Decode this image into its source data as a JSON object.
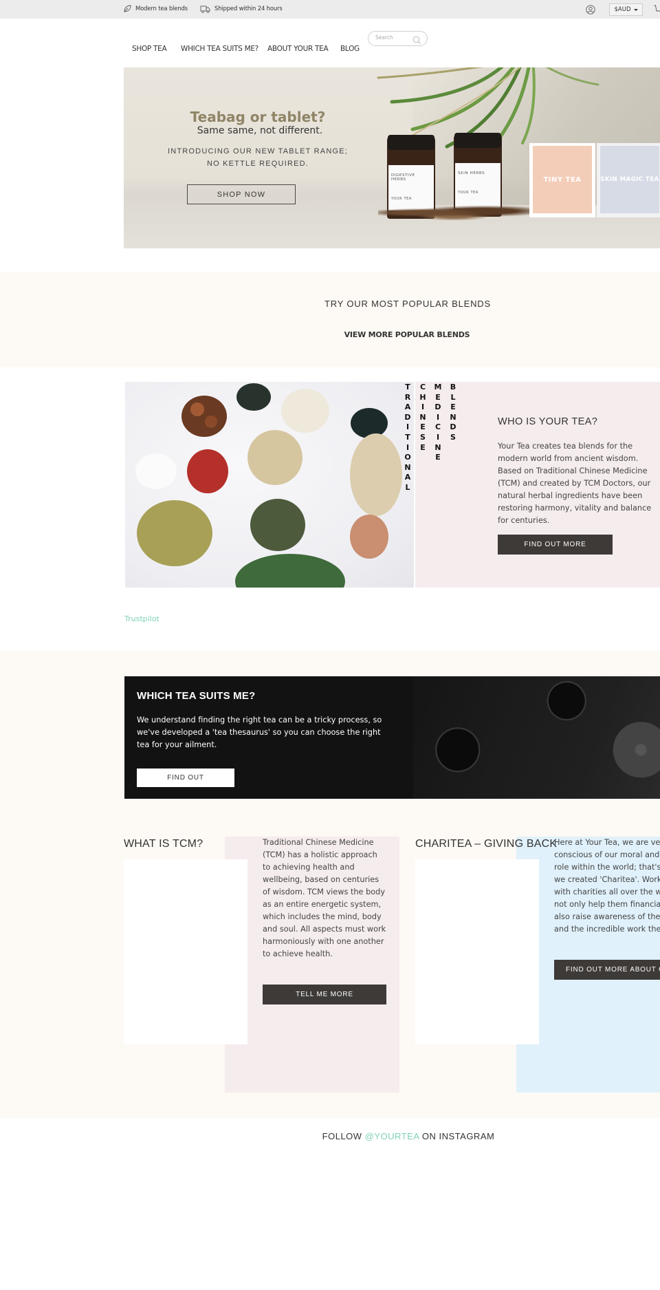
{
  "topbar": {
    "features": [
      {
        "icon": "leaf-icon",
        "label": "Modern tea blends"
      },
      {
        "icon": "truck-icon",
        "label": "Shipped within 24 hours"
      }
    ],
    "currency": "$AUD"
  },
  "nav": {
    "items": [
      "SHOP TEA",
      "WHICH TEA SUITS ME?",
      "ABOUT YOUR TEA",
      "BLOG"
    ],
    "search_placeholder": "Search"
  },
  "hero": {
    "title": "Teabag or tablet?",
    "subtitle": "Same same, not different.",
    "intro_line1": "INTRODUCING OUR NEW TABLET RANGE;",
    "intro_line2": "NO KETTLE REQUIRED.",
    "cta": "SHOP NOW",
    "products": [
      "DIGESTIVE HERBS",
      "SKIN HERBS",
      "TINY TEA",
      "SKIN MAGIC TEA"
    ],
    "brand": "YOUR TEA"
  },
  "popular": {
    "title": "TRY OUR MOST POPULAR BLENDS",
    "link": "VIEW MORE POPULAR BLENDS"
  },
  "who": {
    "vertical_words": [
      "TRADITIONAL",
      "CHINESE",
      "MEDICINE",
      "BLENDS"
    ],
    "title": "WHO IS YOUR TEA?",
    "text": "Your Tea creates tea blends for the modern world from ancient wisdom. Based on Traditional Chinese Medicine (TCM) and created by TCM Doctors, our natural herbal ingredients have been restoring harmony, vitality and balance for centuries.",
    "cta": "FIND OUT MORE"
  },
  "trustpilot": "Trustpilot",
  "suits": {
    "title": "WHICH TEA SUITS ME?",
    "text": "We understand finding the right tea can be a tricky process, so we've developed a 'tea thesaurus' so you can choose the right tea for your ailment.",
    "cta": "FIND OUT"
  },
  "tcm": {
    "title": "WHAT IS TCM?",
    "text": "Traditional Chinese Medicine (TCM) has a holistic approach to achieving health and wellbeing, based on centuries of wisdom. TCM views the body as an entire energetic system, which includes the mind, body and soul. All aspects must work harmoniously with one another to achieve health.",
    "cta": "TELL ME MORE"
  },
  "charitea": {
    "title": "CHARITEA – GIVING BACK",
    "lines": [
      "Here at Your Tea, we are very",
      "conscious of our moral and eth",
      "role within the world; that's wh",
      "we created 'Charitea'. Working",
      "with charities all over the world",
      "not only help them financially,",
      "also raise awareness of their ca",
      "and the incredible work they d"
    ],
    "cta": "FIND OUT MORE ABOUT CHARITEA"
  },
  "instagram": {
    "prefix": "FOLLOW ",
    "handle": "@YOURTEA",
    "suffix": " ON INSTAGRAM"
  },
  "colors": {
    "accent_mint": "#7fd2b3",
    "hero_title": "#8f8466",
    "pink_panel": "#f5eced",
    "blue_panel": "#e0f1fb",
    "cream": "#fdf9f4",
    "dark_button": "#3d3a38"
  }
}
